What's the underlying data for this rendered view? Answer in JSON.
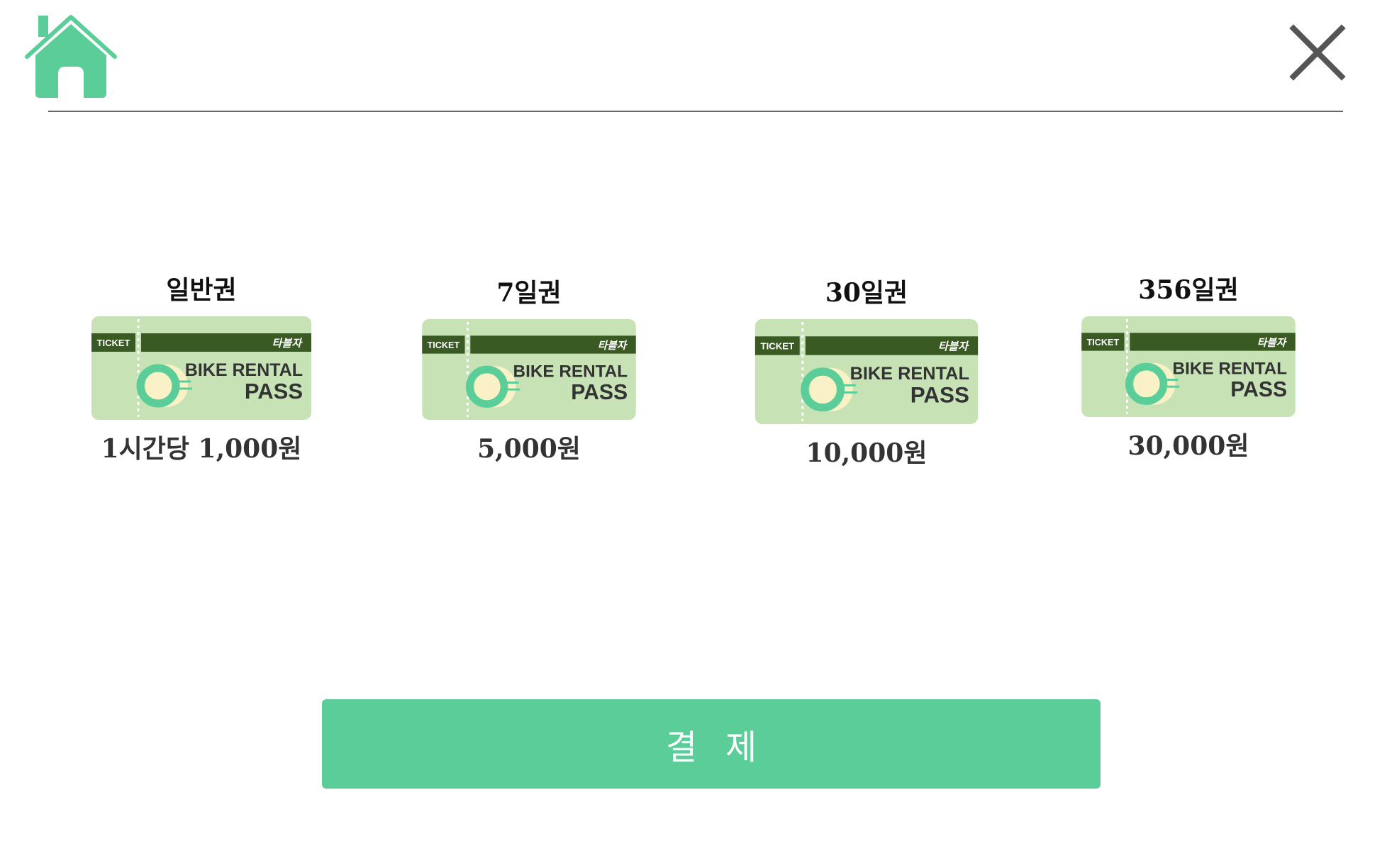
{
  "header": {
    "home_icon": "home-icon",
    "close_icon": "close-icon"
  },
  "tickets": [
    {
      "title": "일반권",
      "price": "1시간당 1,000원"
    },
    {
      "title": "7일권",
      "price": "5,000원"
    },
    {
      "title": "30일권",
      "price": "10,000원"
    },
    {
      "title": "356일권",
      "price": "30,000원"
    }
  ],
  "ticket_art": {
    "stub_label": "TICKET",
    "brand_label": "타블자",
    "line1": "BIKE RENTAL",
    "line2": "PASS"
  },
  "pay_button": {
    "label": "결제"
  },
  "colors": {
    "accent": "#5ACD98",
    "ticket_bg": "#C7E3B5",
    "ticket_band": "#3A5A23",
    "divider": "#666666",
    "close": "#555555"
  }
}
